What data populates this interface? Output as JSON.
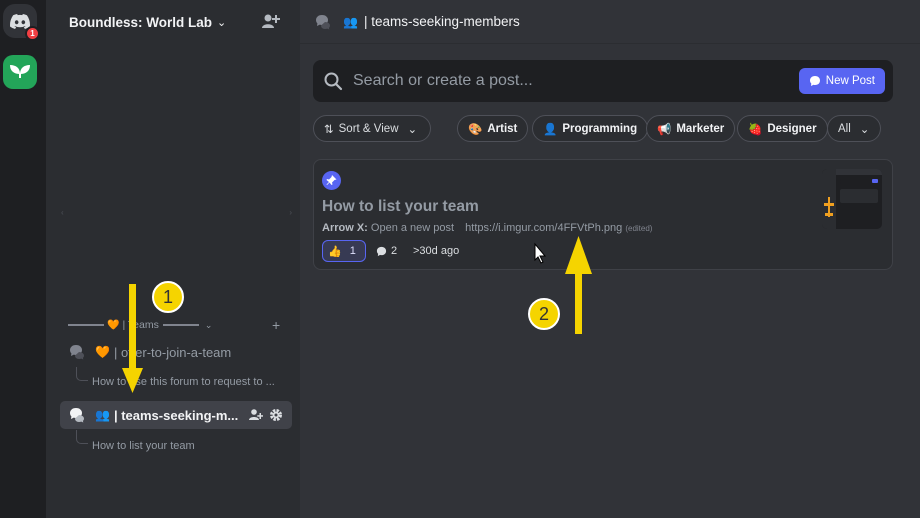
{
  "rail": {
    "home_badge": "1",
    "server_label": "World Lab"
  },
  "guild": {
    "name": "Boundless: World Lab"
  },
  "category": {
    "emoji": "🧡",
    "label": "| Teams"
  },
  "channels": [
    {
      "emoji": "🧡",
      "name": "| offer-to-join-a-team",
      "thread": "How to use this forum to request to ..."
    },
    {
      "emoji": "👥",
      "name": "| teams-seeking-m...",
      "thread": "How to list your team"
    }
  ],
  "topbar": {
    "title": "| teams-seeking-members"
  },
  "search": {
    "placeholder": "Search or create a post...",
    "new_post": "New Post"
  },
  "filters": {
    "sort": "Sort & View",
    "tags": [
      {
        "emoji": "🎨",
        "label": "Artist"
      },
      {
        "emoji": "👤",
        "label": "Programming"
      },
      {
        "emoji": "📢",
        "label": "Marketer"
      },
      {
        "emoji": "🍓",
        "label": "Designer"
      }
    ],
    "all": "All"
  },
  "post": {
    "title": "How to list your team",
    "author": "Arrow X:",
    "preview": "Open a new post",
    "link": "https://i.imgur.com/4FFVtPh.png",
    "edited": "(edited)",
    "reaction_emoji": "👍",
    "reaction_count": "1",
    "message_count": "2",
    "time": ">30d ago"
  },
  "annotations": {
    "step1": "1",
    "step2": "2"
  },
  "colors": {
    "accent": "#5865f2",
    "annotation": "#f5d400"
  }
}
